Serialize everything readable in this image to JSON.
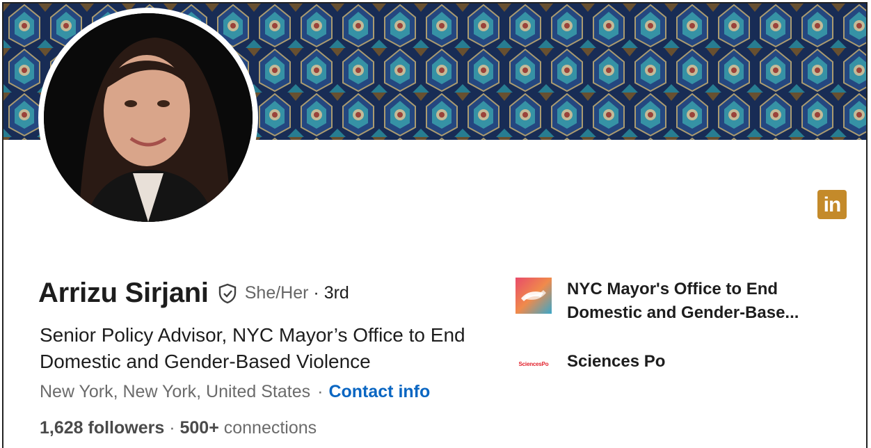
{
  "profile": {
    "name": "Arrizu Sirjani",
    "pronouns": "She/Her",
    "degree": "· 3rd",
    "headline": "Senior Policy Advisor, NYC Mayor’s Office to End Domestic and Gender-Based Violence",
    "location": "New York, New York, United States",
    "location_separator": "·",
    "contact_label": "Contact info",
    "followers": "1,628 followers",
    "connections_sep": "·",
    "connections_count": "500+",
    "connections_label": "connections"
  },
  "badge": {
    "label": "in",
    "color": "#c48a2a"
  },
  "organizations": [
    {
      "name": "NYC Mayor's Office to End Domestic and Gender-Base...",
      "icon": "nyc-mayors-office-logo"
    },
    {
      "name": "Sciences Po",
      "logo_text": "SciencesPo",
      "icon": "sciences-po-logo"
    }
  ],
  "colors": {
    "link": "#0a66c2",
    "text": "#1d1d1d",
    "muted": "#6b6b6b"
  }
}
